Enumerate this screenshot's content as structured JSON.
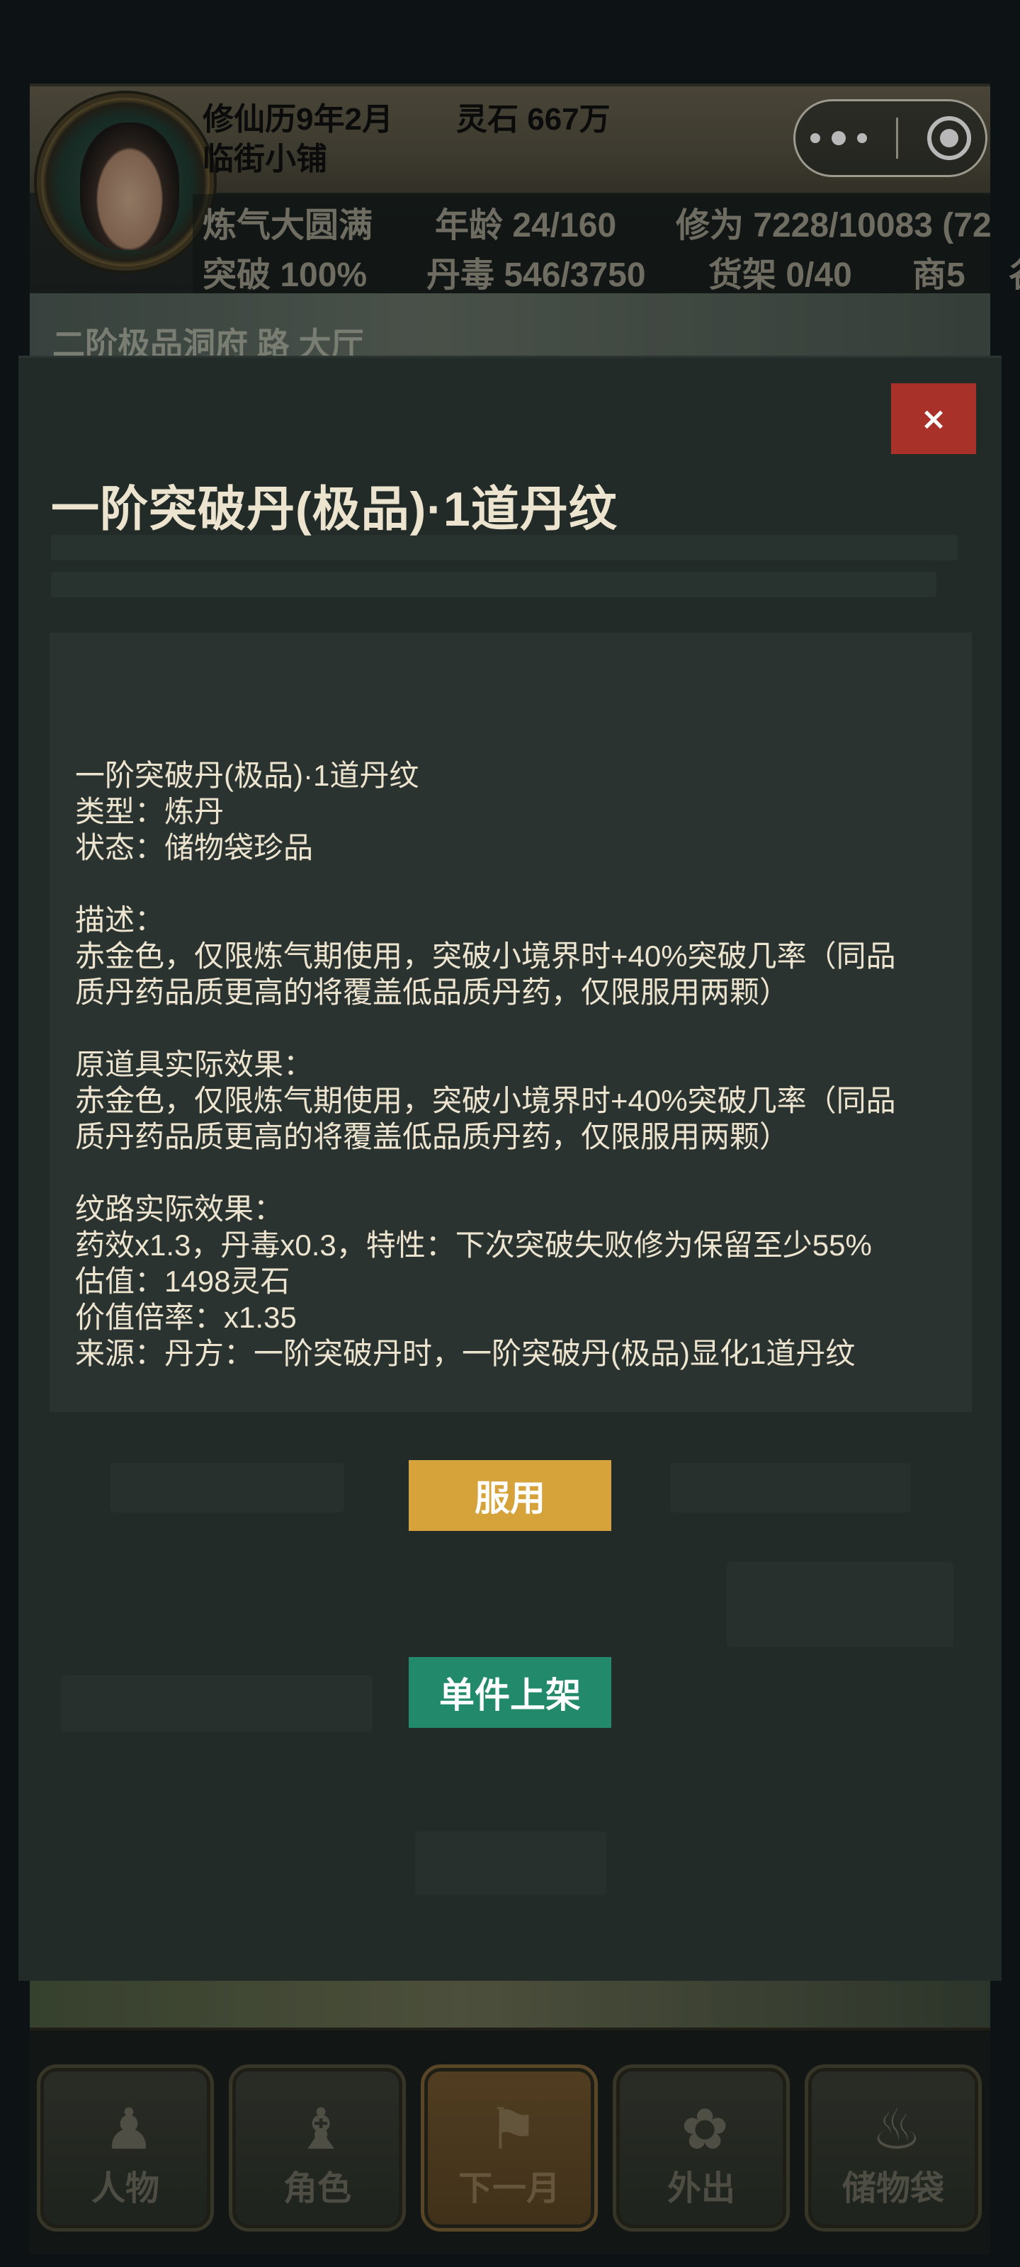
{
  "header": {
    "calendar": "修仙历9年2月",
    "spirit_stones": "灵石 667万",
    "shop_name": "临街小铺",
    "realm": "炼气大圆满",
    "age": "年龄 24/160",
    "cultivation": "修为 7228/10083 (72",
    "breakthrough": "突破 100%",
    "pill_toxin": "丹毒 546/3750",
    "shelf": "货架 0/40",
    "merchant": "商5",
    "overflow_char": "谷"
  },
  "location": {
    "text": "二阶极品洞府 路 大厅"
  },
  "capsule": {
    "menu_icon": "more-dots-icon",
    "close_icon": "target-circle-icon"
  },
  "modal": {
    "close_label": "×",
    "title": "一阶突破丹(极品)·1道丹纹",
    "lines": [
      "一阶突破丹(极品)·1道丹纹",
      "类型：炼丹",
      "状态：储物袋珍品",
      "",
      "描述：",
      "赤金色，仅限炼气期使用，突破小境界时+40%突破几率（同品",
      "质丹药品质更高的将覆盖低品质丹药，仅限服用两颗）",
      "",
      "原道具实际效果：",
      "赤金色，仅限炼气期使用，突破小境界时+40%突破几率（同品",
      "质丹药品质更高的将覆盖低品质丹药，仅限服用两颗）",
      "",
      "纹路实际效果：",
      "药效x1.3，丹毒x0.3，特性：下次突破失败修为保留至少55%",
      "估值：1498灵石",
      "价值倍率：x1.35",
      "来源：丹方：一阶突破丹时，一阶突破丹(极品)显化1道丹纹"
    ],
    "use_button": "服用",
    "list_button": "单件上架"
  },
  "nav": {
    "items": [
      {
        "label": "人物",
        "icon": "person-icon"
      },
      {
        "label": "角色",
        "icon": "character-icon"
      },
      {
        "label": "下一月",
        "icon": "flag-icon"
      },
      {
        "label": "外出",
        "icon": "travel-icon"
      },
      {
        "label": "储物袋",
        "icon": "bag-icon"
      }
    ]
  },
  "colors": {
    "close_button": "#a8322a",
    "use_button": "#d6a23a",
    "list_button": "#228a6b",
    "modal_bg": "#222b28"
  }
}
